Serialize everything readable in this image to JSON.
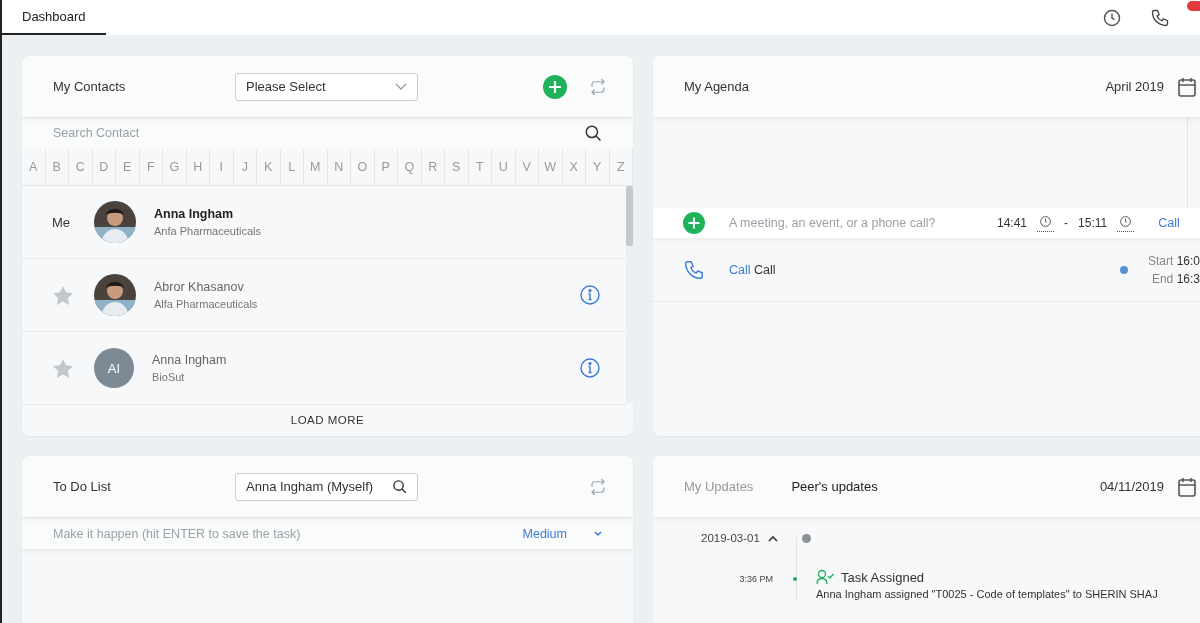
{
  "top_bar": {
    "tabs": [
      {
        "label": "Dashboard",
        "selected": true
      }
    ],
    "notifications": {
      "badge": true
    }
  },
  "contacts": {
    "title": "My Contacts",
    "filter": {
      "placeholder": "Please Select"
    },
    "search": {
      "placeholder": "Search Contact"
    },
    "letters": [
      "A",
      "B",
      "C",
      "D",
      "E",
      "F",
      "G",
      "H",
      "I",
      "J",
      "K",
      "L",
      "M",
      "N",
      "O",
      "P",
      "Q",
      "R",
      "S",
      "T",
      "U",
      "V",
      "W",
      "X",
      "Y",
      "Z"
    ],
    "items": [
      {
        "kind": "me",
        "lead": "Me",
        "name": "Anna Ingham",
        "company": "Anfa Pharmaceuticals"
      },
      {
        "kind": "contact",
        "starred": false,
        "name": "Abror Khasanov",
        "company": "Alfa Pharmaceuticals"
      },
      {
        "kind": "contact",
        "starred": false,
        "avatar": {
          "kind": "initials",
          "text": "AI"
        },
        "name": "Anna Ingham",
        "company": "BioSut"
      }
    ],
    "load_more": "LOAD MORE"
  },
  "agenda": {
    "title": "My Agenda",
    "month": "April 2019",
    "new_entry": {
      "placeholder": "A meeting, an event, or a phone call?",
      "start": "14:41",
      "separator": "-",
      "end": "15:11",
      "type": "Call"
    },
    "events": [
      {
        "kind": "call",
        "type_label": "Call",
        "title": "Call",
        "color": "#5b8fd8",
        "start_label": "Start",
        "start": "16:0",
        "end_label": "End",
        "end": "16:3"
      }
    ]
  },
  "todo": {
    "title": "To Do List",
    "assignee": "Anna Ingham (Myself)",
    "task": {
      "placeholder": "Make it happen (hit ENTER to save the task)"
    },
    "priority": "Medium"
  },
  "updates": {
    "tabs": [
      {
        "label": "My Updates",
        "selected": false
      },
      {
        "label": "Peer's updates",
        "selected": true
      }
    ],
    "date": "04/11/2019",
    "groups": [
      {
        "date": "2019-03-01",
        "expanded": true,
        "entries": [
          {
            "time": "3:36 PM",
            "title": "Task Assigned",
            "text": "Anna Ingham assigned \"T0025 - Code of templates\" to SHERIN SHAJ"
          }
        ]
      }
    ]
  }
}
